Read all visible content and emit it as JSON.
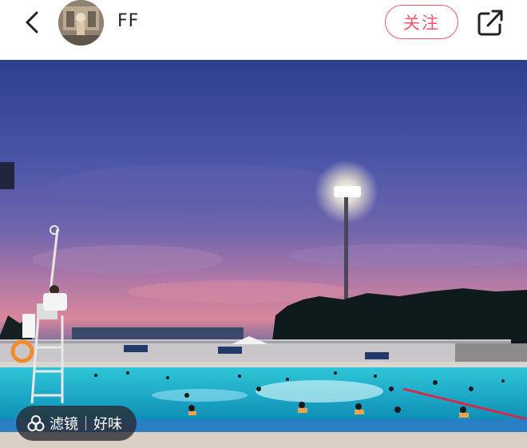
{
  "header": {
    "username": "FF",
    "follow_label": "关注",
    "back_icon": "chevron-left-icon",
    "share_icon": "share-icon"
  },
  "photo": {
    "description_icon": "filter-icon"
  },
  "filter_chip": {
    "filter_label": "滤镜",
    "filter_name": "好味"
  },
  "colors": {
    "accent": "#f0576b",
    "text_primary": "#222222"
  }
}
